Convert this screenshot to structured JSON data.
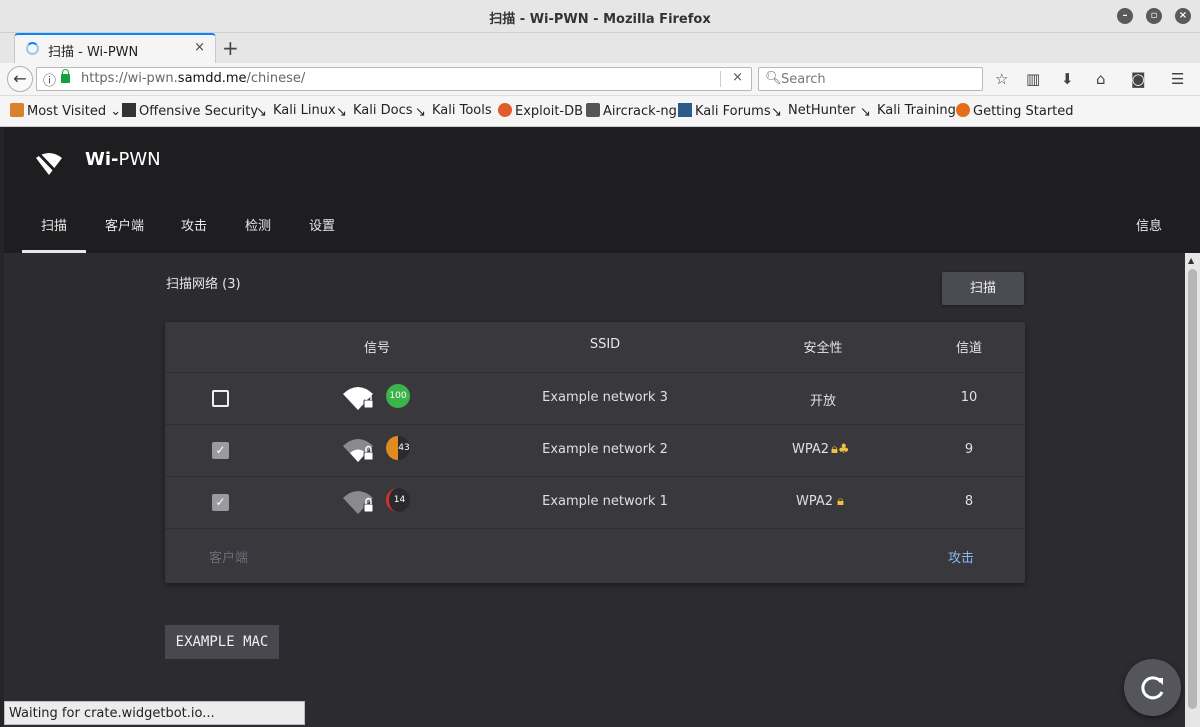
{
  "window": {
    "title": "扫描 - Wi-PWN - Mozilla Firefox"
  },
  "tab": {
    "label": "扫描 - Wi-PWN",
    "close": "×",
    "new_tab": "+"
  },
  "urlbar": {
    "url_prefix": "https://wi-pwn.",
    "url_domain": "samdd.me",
    "url_path": "/chinese/",
    "clear": "×"
  },
  "search": {
    "placeholder": "Search"
  },
  "bookmarks": [
    {
      "label": "Most Visited",
      "icon": "folder-icon"
    },
    {
      "label": "Offensive Security",
      "icon": "offsec-icon"
    },
    {
      "label": "Kali Linux",
      "icon": "kali-dragon-icon"
    },
    {
      "label": "Kali Docs",
      "icon": "kali-dragon-icon"
    },
    {
      "label": "Kali Tools",
      "icon": "kali-dragon-icon"
    },
    {
      "label": "Exploit-DB",
      "icon": "exploitdb-icon"
    },
    {
      "label": "Aircrack-ng",
      "icon": "aircrack-icon"
    },
    {
      "label": "Kali Forums",
      "icon": "kali-forums-icon"
    },
    {
      "label": "NetHunter",
      "icon": "kali-dragon-icon"
    },
    {
      "label": "Kali Training",
      "icon": "kali-dragon-icon"
    },
    {
      "label": "Getting Started",
      "icon": "firefox-icon"
    }
  ],
  "app": {
    "brand_bold": "Wi-",
    "brand_rest": "PWN",
    "nav": [
      "扫描",
      "客户端",
      "攻击",
      "检测",
      "设置"
    ],
    "nav_right": "信息",
    "active_nav": "扫描"
  },
  "scan": {
    "title": "扫描网络 (3)",
    "button": "扫描",
    "columns": [
      "信号",
      "SSID",
      "安全性",
      "信道"
    ],
    "rows": [
      {
        "checked": false,
        "signal": "100",
        "signal_color": "#3bb54a",
        "ssid": "Example network 3",
        "security": "开放",
        "channel": "10"
      },
      {
        "checked": true,
        "signal": "43",
        "signal_color": "#e38a1e",
        "ssid": "Example network 2",
        "security": "WPA2",
        "channel": "9"
      },
      {
        "checked": true,
        "signal": "14",
        "signal_color": "#d32f2f",
        "ssid": "Example network 1",
        "security": "WPA2",
        "channel": "8"
      }
    ],
    "footer_left": "客户端",
    "footer_right": "攻击"
  },
  "mac_label": "EXAMPLE MAC",
  "status_text": "Waiting for crate.widgetbot.io..."
}
